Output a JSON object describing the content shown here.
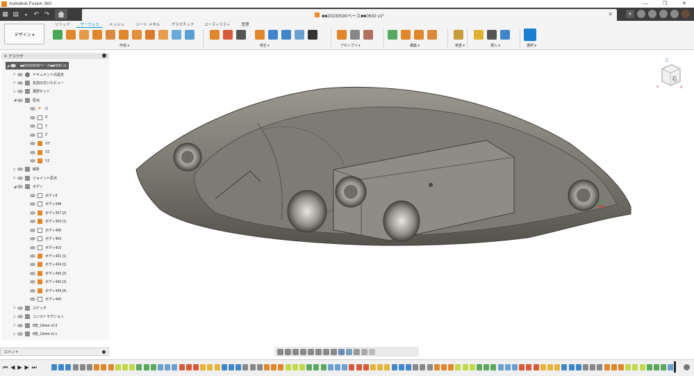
{
  "window": {
    "app_title": "Autodesk Fusion 360",
    "min": "—",
    "max": "❐",
    "close": "✕"
  },
  "doc_tab": {
    "title": "■■20230530ベース■■0630 v1*",
    "close": "✕"
  },
  "toolbar": {
    "design_label": "デザイン ▾",
    "tabs": [
      "ソリッド",
      "サーフェス",
      "メッシュ",
      "シート メタル",
      "プラスチック",
      "ユーティリティ",
      "管理"
    ],
    "active_tab": "サーフェス",
    "groups": [
      "作成 ▾",
      "修正 ▾",
      "アセンブリ ▾",
      "構築 ▾",
      "検査 ▾",
      "挿入 ▾",
      "選択 ▾"
    ]
  },
  "browser": {
    "title": "ブラウザ",
    "root": "■■20230530ベース■■0630 v1",
    "items": [
      {
        "label": "ドキュメントの設定",
        "level": 1,
        "icon": "gear"
      },
      {
        "label": "名前の付いたビュー",
        "level": 1,
        "icon": "folder"
      },
      {
        "label": "選択セット",
        "level": 1,
        "icon": "folder"
      },
      {
        "label": "原点",
        "level": 1,
        "icon": "folder",
        "open": true
      },
      {
        "label": "O",
        "level": 2,
        "icon": "origin"
      },
      {
        "label": "X",
        "level": 2,
        "icon": "white"
      },
      {
        "label": "Y",
        "level": 2,
        "icon": "white"
      },
      {
        "label": "Z",
        "level": 2,
        "icon": "white"
      },
      {
        "label": "XY",
        "level": 2,
        "icon": "orange"
      },
      {
        "label": "XZ",
        "level": 2,
        "icon": "orange"
      },
      {
        "label": "YZ",
        "level": 2,
        "icon": "orange"
      },
      {
        "label": "解析",
        "level": 1,
        "icon": "folder"
      },
      {
        "label": "ジョイント原点",
        "level": 1,
        "icon": "folder"
      },
      {
        "label": "ボディ",
        "level": 1,
        "icon": "folder",
        "open": true
      },
      {
        "label": "ボディ8",
        "level": 2,
        "icon": "white"
      },
      {
        "label": "ボディ348",
        "level": 2,
        "icon": "white"
      },
      {
        "label": "ボディ357 (2)",
        "level": 2,
        "icon": "orange"
      },
      {
        "label": "ボディ359 (1)",
        "level": 2,
        "icon": "orange"
      },
      {
        "label": "ボディ408",
        "level": 2,
        "icon": "white"
      },
      {
        "label": "ボディ409",
        "level": 2,
        "icon": "white"
      },
      {
        "label": "ボディ410",
        "level": 2,
        "icon": "white"
      },
      {
        "label": "ボディ431 (1)",
        "level": 2,
        "icon": "orange"
      },
      {
        "label": "ボディ434 (1)",
        "level": 2,
        "icon": "orange"
      },
      {
        "label": "ボディ435 (2)",
        "level": 2,
        "icon": "orange"
      },
      {
        "label": "ボディ436 (3)",
        "level": 2,
        "icon": "orange"
      },
      {
        "label": "ボディ439 (4)",
        "level": 2,
        "icon": "orange"
      },
      {
        "label": "ボディ440",
        "level": 2,
        "icon": "white"
      },
      {
        "label": "スケッチ",
        "level": 1,
        "icon": "folder"
      },
      {
        "label": "コンストラクション",
        "level": 1,
        "icon": "folder"
      },
      {
        "label": "8管_10mm v1:3",
        "level": 1,
        "icon": "link"
      },
      {
        "label": "8管_10mm v1:1",
        "level": 1,
        "icon": "link"
      }
    ]
  },
  "comment": {
    "label": "コメント"
  },
  "viewcube": {
    "face": "右"
  },
  "colors": {
    "accent": "#0696d7",
    "orange": "#e0872b",
    "model": "#7c7a72"
  }
}
